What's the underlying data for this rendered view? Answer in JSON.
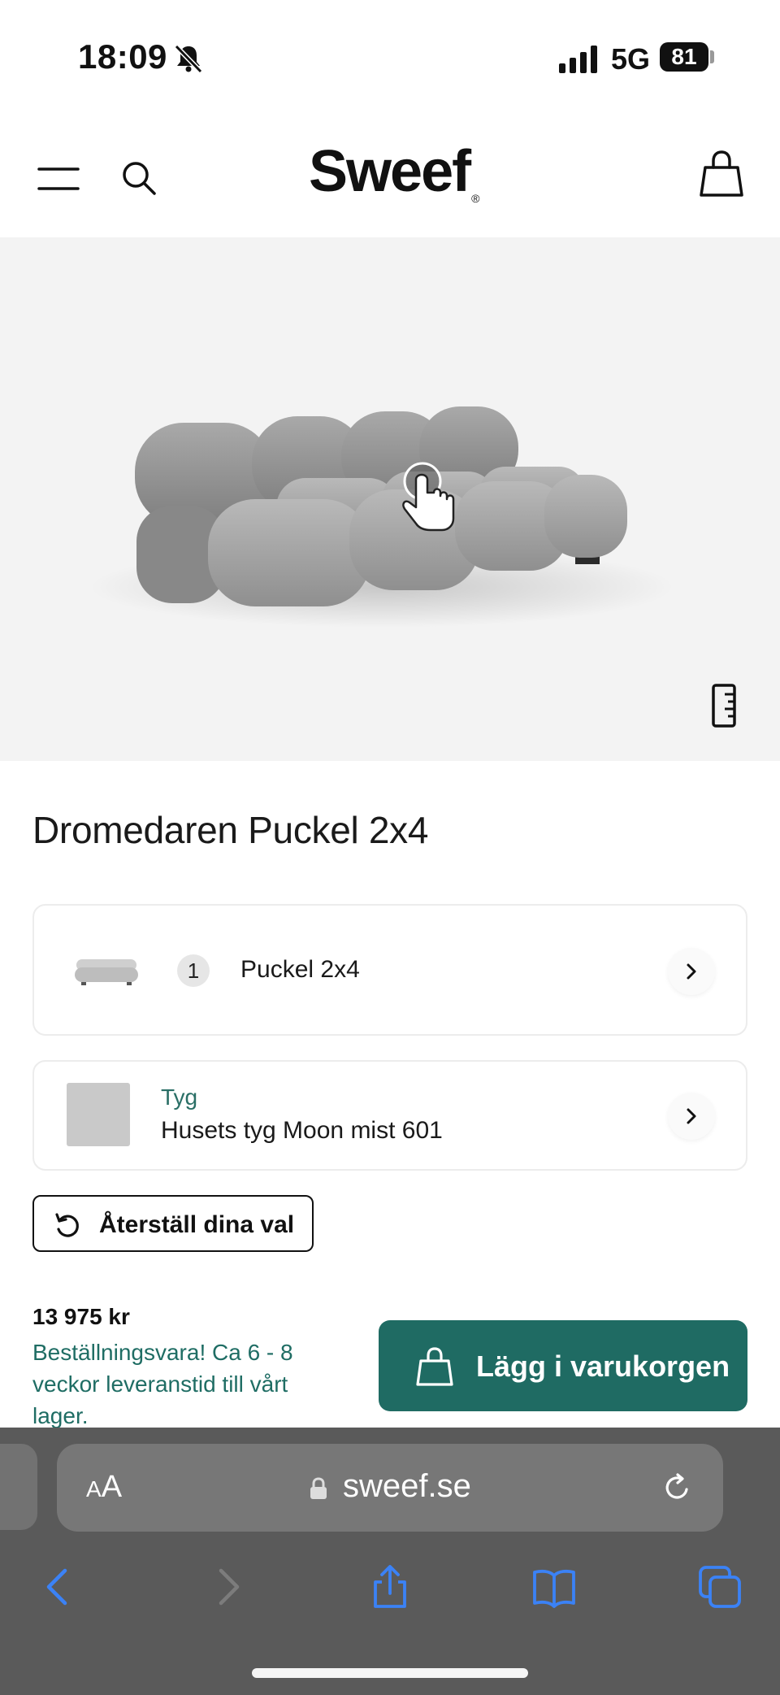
{
  "status_bar": {
    "time": "18:09",
    "network": "5G",
    "battery": "81"
  },
  "header": {
    "logo": "Sweef",
    "logo_mark": "®",
    "icons": [
      "hamburger-icon",
      "search-icon",
      "shopping-bag-icon"
    ]
  },
  "product": {
    "title": "Dromedaren Puckel 2x4",
    "stage_icons": [
      "tap-hand-icon",
      "ruler-icon"
    ]
  },
  "configuration": {
    "quantity": "1",
    "label": "Puckel 2x4"
  },
  "fabric": {
    "category": "Tyg",
    "name": "Husets tyg Moon mist 601",
    "swatch_color": "#c9c9c9"
  },
  "reset": {
    "label": "Återställ dina val"
  },
  "purchase": {
    "price": "13 975 kr",
    "delivery_note": "Beställningsvara! Ca 6 - 8 veckor leveranstid till vårt lager.",
    "add_to_cart_label": "Lägg i varukorgen"
  },
  "browser": {
    "text_size_small": "A",
    "text_size_large": "A",
    "url": "sweef.se",
    "toolbar": [
      "back-icon",
      "forward-icon",
      "share-icon",
      "bookmarks-icon",
      "tabs-icon"
    ]
  },
  "colors": {
    "accent": "#1f6b63",
    "accent_text": "#1f6d64",
    "browser_link": "#3b82f6",
    "stage_bg": "#f3f3f3"
  }
}
